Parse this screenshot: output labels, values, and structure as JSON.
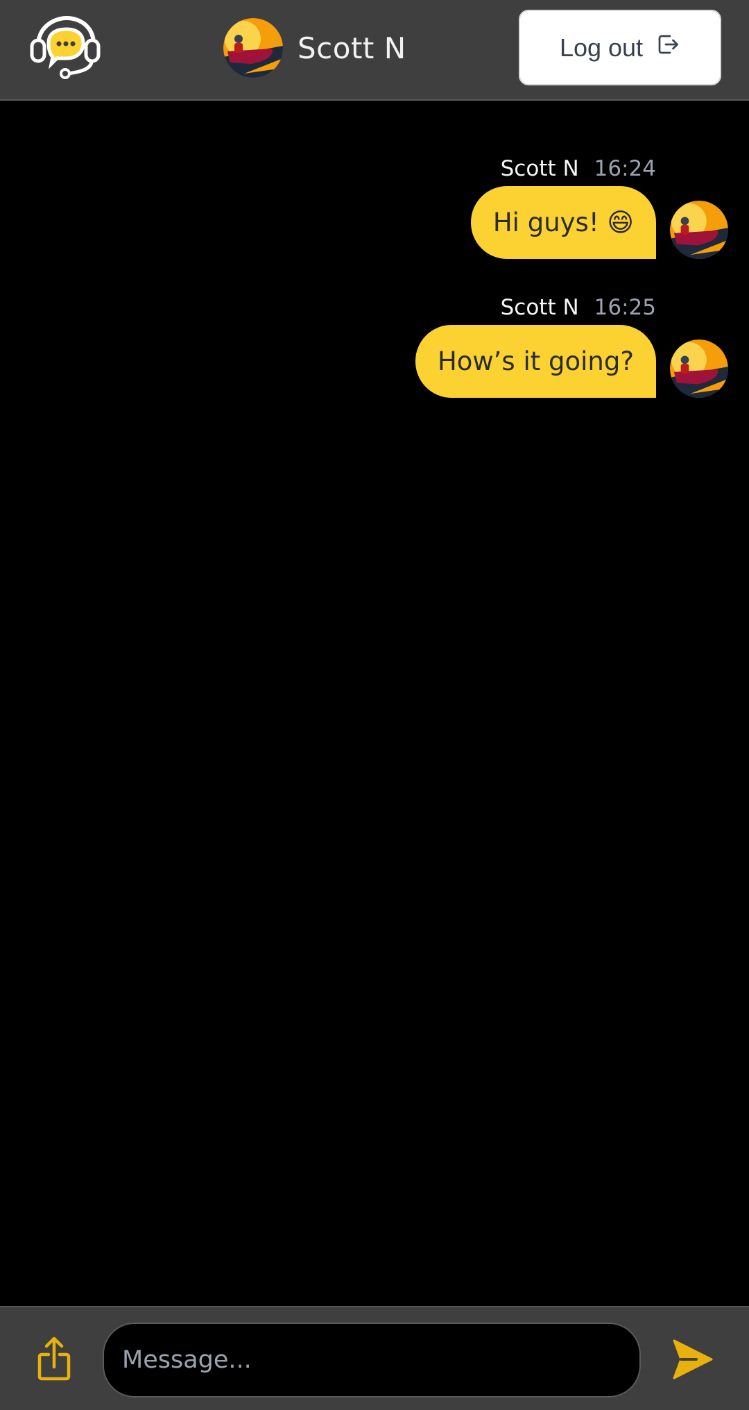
{
  "app": {
    "accent": "#fbd232",
    "header_bg": "#3f3f3f"
  },
  "header": {
    "logo_icon": "support-chat-icon",
    "user": {
      "name": "Scott N",
      "avatar": "jetski-avatar"
    },
    "logout": {
      "label": "Log out",
      "icon": "logout-icon"
    }
  },
  "messages": [
    {
      "author": "Scott N",
      "time": "16:24",
      "text": "Hi guys! 😄"
    },
    {
      "author": "Scott N",
      "time": "16:25",
      "text": "How’s it going?"
    }
  ],
  "composer": {
    "share_icon": "share-icon",
    "placeholder": "Message...",
    "value": "",
    "send_icon": "send-icon"
  }
}
